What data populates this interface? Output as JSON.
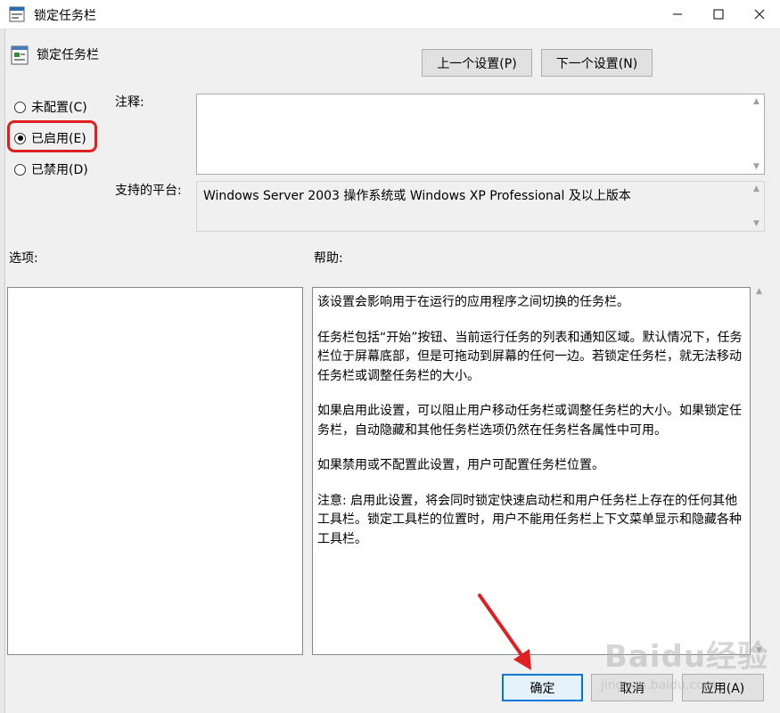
{
  "window": {
    "title": "锁定任务栏",
    "controls": [
      "minimize",
      "maximize",
      "close"
    ]
  },
  "header": {
    "policy_name": "锁定任务栏",
    "prev_button": "上一个设置(P)",
    "next_button": "下一个设置(N)"
  },
  "radios": {
    "not_configured": "未配置(C)",
    "enabled": "已启用(E)",
    "disabled": "已禁用(D)",
    "selected": "enabled"
  },
  "comment": {
    "label": "注释:",
    "value": ""
  },
  "platform": {
    "label": "支持的平台:",
    "value": "Windows Server 2003 操作系统或 Windows XP Professional 及以上版本"
  },
  "options": {
    "label": "选项:"
  },
  "help": {
    "label": "帮助:",
    "paragraphs": [
      "该设置会影响用于在运行的应用程序之间切换的任务栏。",
      "任务栏包括“开始”按钮、当前运行任务的列表和通知区域。默认情况下，任务栏位于屏幕底部，但是可拖动到屏幕的任何一边。若锁定任务栏，就无法移动任务栏或调整任务栏的大小。",
      "如果启用此设置，可以阻止用户移动任务栏或调整任务栏的大小。如果锁定任务栏，自动隐藏和其他任务栏选项仍然在任务栏各属性中可用。",
      "如果禁用或不配置此设置，用户可配置任务栏位置。",
      "注意: 启用此设置，将会同时锁定快速启动栏和用户任务栏上存在的任何其他工具栏。锁定工具栏的位置时，用户不能用任务栏上下文菜单显示和隐藏各种工具栏。"
    ]
  },
  "buttons": {
    "ok": "确定",
    "cancel": "取消",
    "apply": "应用(A)"
  },
  "watermark": {
    "brand": "Baidu经验",
    "url": "jingyan.baidu.com"
  },
  "colors": {
    "highlight": "#e02020",
    "default_button_border": "#0078d7"
  }
}
